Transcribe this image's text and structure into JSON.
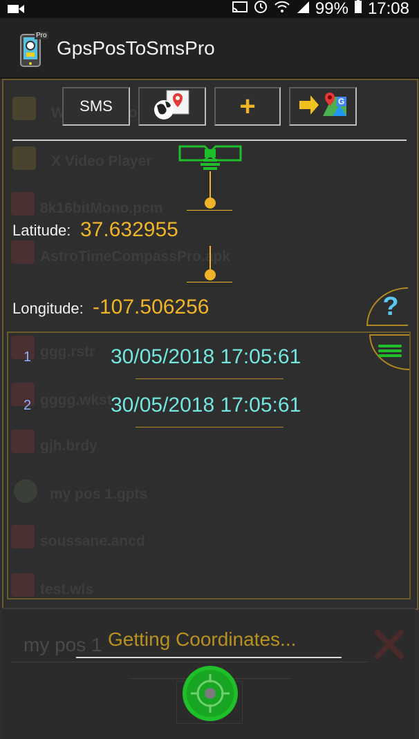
{
  "status": {
    "battery": "99%",
    "time": "17:08"
  },
  "app": {
    "title": "GpsPosToSmsPro",
    "pro_badge": "Pro"
  },
  "toolbar": {
    "sms_label": "SMS",
    "plus_label": "+"
  },
  "background_files": [
    "WifiCodeStore",
    "X Video Player",
    "8k16bitMono.pcm",
    "AstroTimeCompassPro.apk",
    "ggg.rstr",
    "gggg.wkst",
    "gjh.brdy",
    "my pos 1.gpts",
    "soussane.ancd",
    "test.wls"
  ],
  "coords": {
    "latitude_label": "Latitude:",
    "latitude_value": "37.632955",
    "longitude_label": "Longitude:",
    "longitude_value": "-107.506256"
  },
  "positions": [
    {
      "num": "1",
      "datetime": "30/05/2018 17:05:61"
    },
    {
      "num": "2",
      "datetime": "30/05/2018 17:05:61"
    }
  ],
  "help_label": "?",
  "bottom": {
    "filename_value": "my pos 1",
    "status_text": "Getting Coordinates..."
  },
  "colors": {
    "accent_yellow": "#f0b428",
    "satellite_green": "#1fbf2a",
    "date_teal": "#73e6df",
    "frame_gold": "#6b5a2a"
  }
}
